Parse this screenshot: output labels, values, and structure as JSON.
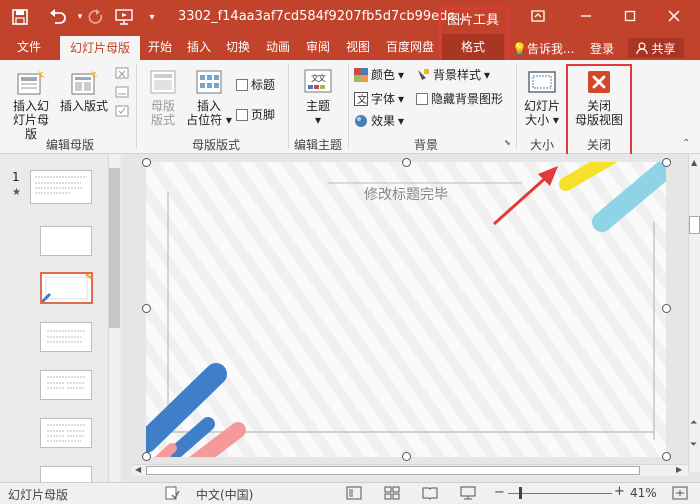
{
  "title_bar": {
    "document_name": "3302_f14aa3af7cd584f9207fb5d7cb99edc...",
    "contextual_tool_title": "图片工具"
  },
  "tabs": {
    "file": "文件",
    "slide_master": "幻灯片母版",
    "home": "开始",
    "insert": "插入",
    "transitions": "切换",
    "animations": "动画",
    "review": "审阅",
    "view": "视图",
    "baidu": "百度网盘",
    "format": "格式"
  },
  "tell_me": "告诉我...",
  "login": "登录",
  "share": "共享",
  "ribbon": {
    "insert_slide_master": [
      "插入幻",
      "灯片母版"
    ],
    "insert_layout": "插入版式",
    "master_layout": [
      "母版",
      "版式"
    ],
    "insert_placeholder": [
      "插入",
      "占位符"
    ],
    "title_checkbox": "标题",
    "footer_checkbox": "页脚",
    "themes": "主题",
    "colors": "颜色",
    "fonts": "字体",
    "effects": "效果",
    "background_styles": "背景样式",
    "hide_background_graphics": "隐藏背景图形",
    "slide_size": [
      "幻灯片",
      "大小"
    ],
    "close_master_view": [
      "关闭",
      "母版视图"
    ],
    "groups": {
      "edit_master": "编辑母版",
      "master_layout": "母版版式",
      "edit_theme": "编辑主题",
      "background": "背景",
      "size": "大小",
      "close": "关闭"
    }
  },
  "thumbnails": {
    "first_number": "1",
    "first_star": "★"
  },
  "slide": {
    "title_text": "修改标题完毕"
  },
  "status_bar": {
    "view_name": "幻灯片母版",
    "language": "中文(中国)",
    "zoom": "41%"
  },
  "colors": {
    "accent": "#c1432c",
    "highlight": "#e23a3a"
  }
}
